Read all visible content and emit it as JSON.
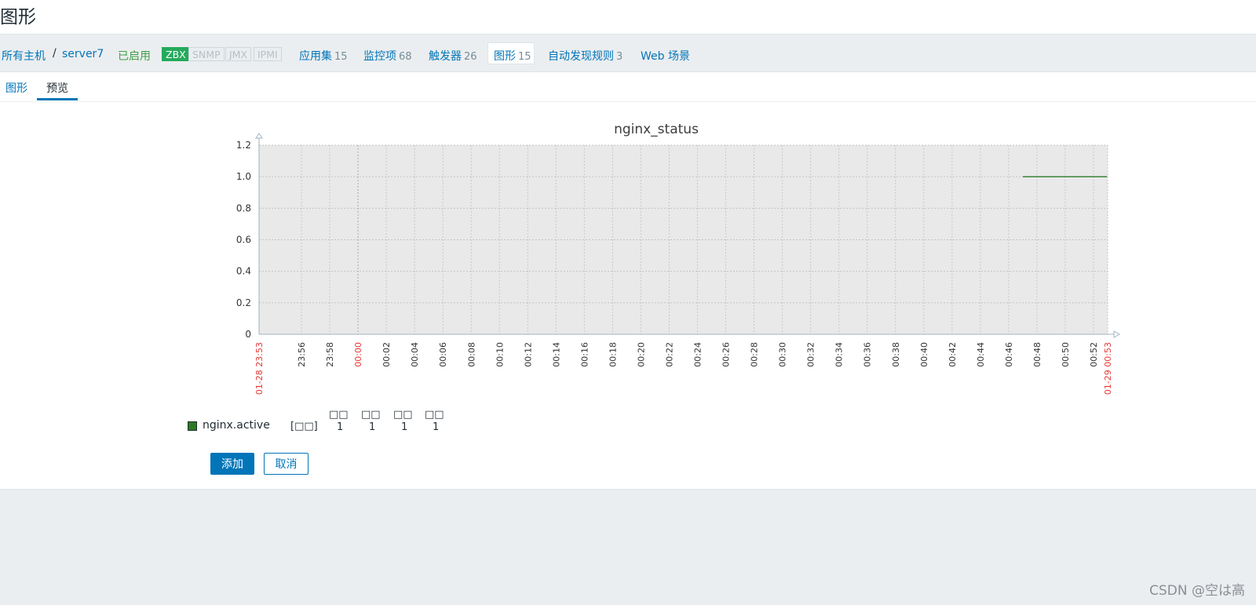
{
  "page": {
    "title": "图形"
  },
  "breadcrumb": {
    "all_hosts": "所有主机",
    "separator": "/",
    "host": "server7",
    "status": "已启用"
  },
  "availability": [
    {
      "label": "ZBX",
      "active": true
    },
    {
      "label": "SNMP",
      "active": false
    },
    {
      "label": "JMX",
      "active": false
    },
    {
      "label": "IPMI",
      "active": false
    }
  ],
  "host_nav": [
    {
      "label": "应用集",
      "count": "15"
    },
    {
      "label": "监控项",
      "count": "68"
    },
    {
      "label": "触发器",
      "count": "26"
    },
    {
      "label": "图形",
      "count": "15"
    },
    {
      "label": "自动发现规则",
      "count": "3"
    },
    {
      "label": "Web 场景",
      "count": ""
    }
  ],
  "tabs": [
    {
      "label": "图形"
    },
    {
      "label": "预览"
    }
  ],
  "chart_data": {
    "type": "line",
    "title": "nginx_status",
    "ylim": [
      0,
      1.2
    ],
    "yticks": [
      "0",
      "0.2",
      "0.4",
      "0.6",
      "0.8",
      "1.0",
      "1.2"
    ],
    "xticks": [
      "23:56",
      "23:58",
      "00:00",
      "00:02",
      "00:04",
      "00:06",
      "00:08",
      "00:10",
      "00:12",
      "00:14",
      "00:16",
      "00:18",
      "00:20",
      "00:22",
      "00:24",
      "00:26",
      "00:28",
      "00:30",
      "00:32",
      "00:34",
      "00:36",
      "00:38",
      "00:40",
      "00:42",
      "00:44",
      "00:46",
      "00:48",
      "00:50",
      "00:52"
    ],
    "x_range": [
      "01-28 23:53",
      "01-29 00:53"
    ],
    "x_range_minutes": [
      0,
      60
    ],
    "grid": true,
    "series": [
      {
        "name": "nginx.active",
        "color": "#2c7a23",
        "x": [
          "00:47",
          "00:53"
        ],
        "y": [
          1,
          1
        ]
      }
    ],
    "legend": {
      "item": "nginx.active",
      "func": "[□□]",
      "headers": [
        "□□",
        "□□",
        "□□",
        "□□"
      ],
      "values": [
        "1",
        "1",
        "1",
        "1"
      ]
    }
  },
  "buttons": {
    "add": "添加",
    "cancel": "取消"
  },
  "watermark": "CSDN @空は高"
}
